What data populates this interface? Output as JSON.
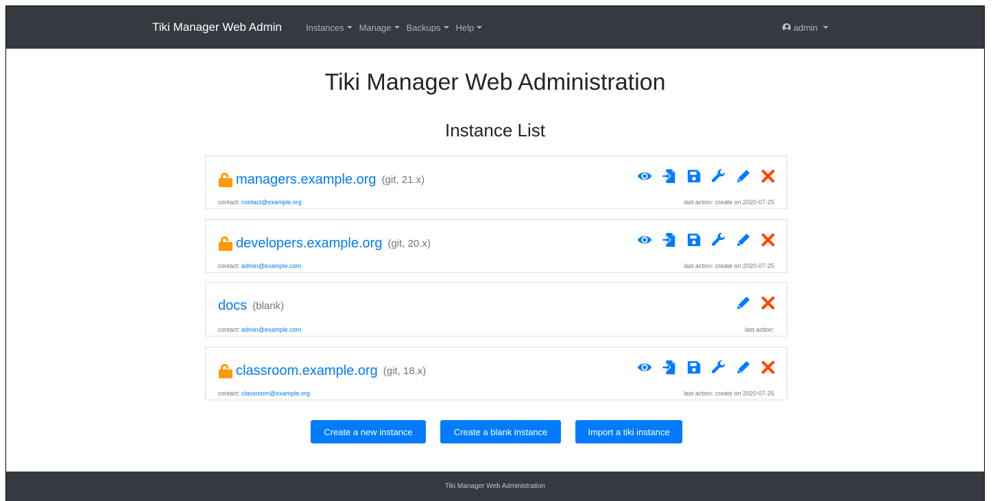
{
  "navbar": {
    "brand": "Tiki Manager Web Admin",
    "menus": [
      "Instances",
      "Manage",
      "Backups",
      "Help"
    ],
    "user": "admin"
  },
  "page": {
    "title": "Tiki Manager Web Administration",
    "list_title": "Instance List"
  },
  "instances": [
    {
      "name": "managers.example.org",
      "meta": "(git, 21.x)",
      "contact_label": "contact:",
      "contact": "contact@example.org",
      "last_action": "last action: create on 2020-07-25",
      "locked_icon": "unlock-icon",
      "actions": [
        "view-icon",
        "import-icon",
        "save-icon",
        "wrench-icon",
        "pencil-icon",
        "close-icon"
      ]
    },
    {
      "name": "developers.example.org",
      "meta": "(git, 20.x)",
      "contact_label": "contact:",
      "contact": "admin@example.com",
      "last_action": "last action: create on 2020-07-25",
      "locked_icon": "unlock-icon",
      "actions": [
        "view-icon",
        "import-icon",
        "save-icon",
        "wrench-icon",
        "pencil-icon",
        "close-icon"
      ]
    },
    {
      "name": "docs",
      "meta": "(blank)",
      "contact_label": "contact:",
      "contact": "admin@example.com",
      "last_action": "last action:",
      "actions": [
        "pencil-icon",
        "close-icon"
      ]
    },
    {
      "name": "classroom.example.org",
      "meta": "(git, 18.x)",
      "contact_label": "contact:",
      "contact": "classroom@example.org",
      "last_action": "last action: create on 2020-07-25",
      "locked_icon": "unlock-icon",
      "actions": [
        "view-icon",
        "import-icon",
        "save-icon",
        "wrench-icon",
        "pencil-icon",
        "close-icon"
      ]
    }
  ],
  "buttons": {
    "create_new": "Create a new instance",
    "create_blank": "Create a blank instance",
    "import": "Import a tiki instance"
  },
  "footer": {
    "text": "Tiki Manager Web Administration"
  },
  "colors": {
    "navbar": "#343a40",
    "primary": "#007bff",
    "lock": "#ff9900",
    "delete": "#ff4400"
  }
}
